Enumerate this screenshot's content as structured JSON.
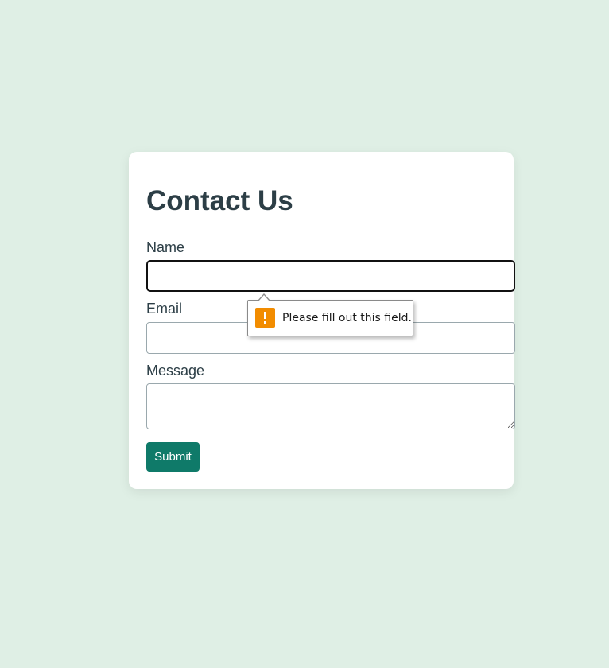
{
  "form": {
    "title": "Contact Us",
    "name_label": "Name",
    "email_label": "Email",
    "message_label": "Message",
    "name_value": "",
    "email_value": "",
    "message_value": "",
    "submit_label": "Submit"
  },
  "validation_tooltip": {
    "message": "Please fill out this field.",
    "icon": "warning-icon"
  },
  "colors": {
    "background": "#dfefe5",
    "card": "#ffffff",
    "text": "#2c3e46",
    "button": "#0f7a69",
    "warning": "#f28c00"
  }
}
